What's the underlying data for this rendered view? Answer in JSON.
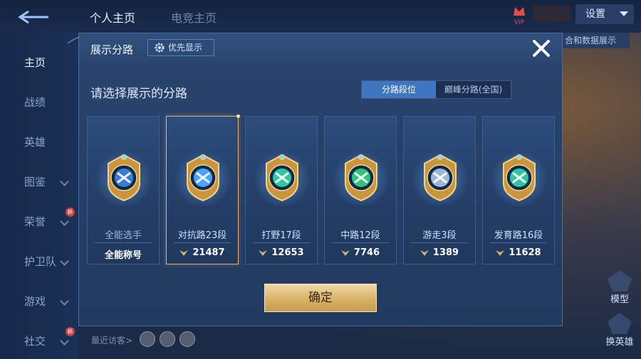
{
  "topbar": {
    "tab_profile": "个人主页",
    "tab_esports": "电竞主页",
    "settings_label": "设置",
    "vip_label": "VIP",
    "side_hint": "合和数据展示"
  },
  "sidebar": {
    "items": [
      {
        "label": "主页",
        "active": true,
        "chevron": false,
        "badge": ""
      },
      {
        "label": "战绩",
        "active": false,
        "chevron": false,
        "badge": ""
      },
      {
        "label": "英雄",
        "active": false,
        "chevron": false,
        "badge": ""
      },
      {
        "label": "图鉴",
        "active": false,
        "chevron": true,
        "badge": ""
      },
      {
        "label": "荣誉",
        "active": false,
        "chevron": true,
        "badge": "新"
      },
      {
        "label": "护卫队",
        "active": false,
        "chevron": true,
        "badge": ""
      },
      {
        "label": "游戏",
        "active": false,
        "chevron": true,
        "badge": ""
      },
      {
        "label": "社交",
        "active": false,
        "chevron": true,
        "badge": "新"
      }
    ]
  },
  "footer": {
    "recent_visitors": "最近访客>",
    "tool_model": "模型",
    "tool_switch_hero": "换英雄"
  },
  "modal": {
    "title": "展示分路",
    "priority_button": "优先显示",
    "subtitle": "请选择展示的分路",
    "segments": [
      "分路段位",
      "巅峰分路(全国)"
    ],
    "active_segment": 0,
    "cards": [
      {
        "rank": "全能选手",
        "score": "全能称号",
        "score_icon": false,
        "selected": false,
        "emblem": "all-round-emblem-icon",
        "accent": "#3a7bd5"
      },
      {
        "rank": "对抗路23段",
        "score": "21487",
        "score_icon": true,
        "selected": true,
        "emblem": "clash-lane-emblem-icon",
        "accent": "#4aa3ff"
      },
      {
        "rank": "打野17段",
        "score": "12653",
        "score_icon": true,
        "selected": false,
        "emblem": "jungle-emblem-icon",
        "accent": "#2fc6a0"
      },
      {
        "rank": "中路12段",
        "score": "7746",
        "score_icon": true,
        "selected": false,
        "emblem": "mid-lane-emblem-icon",
        "accent": "#2fc67a"
      },
      {
        "rank": "游走3段",
        "score": "1389",
        "score_icon": true,
        "selected": false,
        "emblem": "roam-emblem-icon",
        "accent": "#9fb6d8"
      },
      {
        "rank": "发育路16段",
        "score": "11628",
        "score_icon": true,
        "selected": false,
        "emblem": "farm-lane-emblem-icon",
        "accent": "#2fc6a0"
      }
    ],
    "confirm_label": "确定"
  },
  "colors": {
    "gold": "#d9b36a",
    "selected_border": "#e6b070",
    "segment_active": "#3f76c2"
  }
}
